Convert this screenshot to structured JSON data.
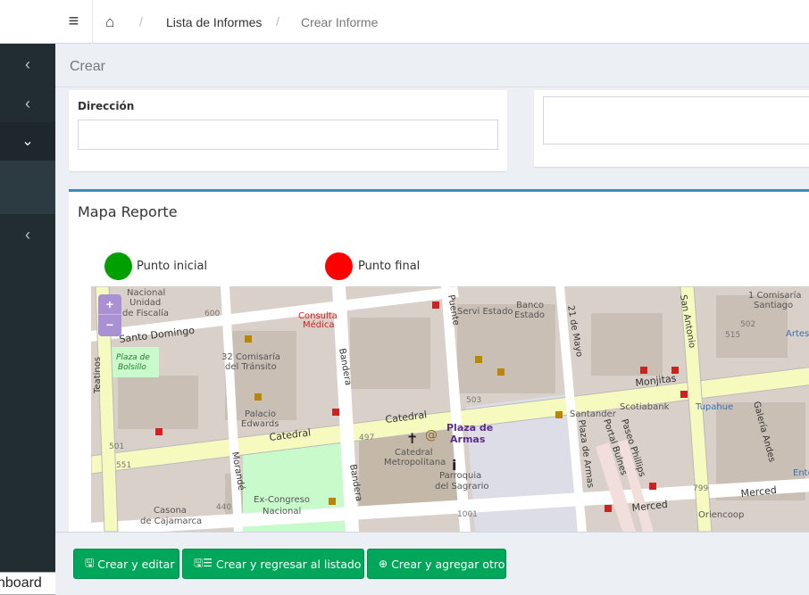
{
  "sidebar": {
    "items": [
      {
        "icon": "chevron-left-icon",
        "glyph": "‹"
      },
      {
        "icon": "chevron-left-icon",
        "glyph": "‹"
      },
      {
        "icon": "chevron-down-icon",
        "glyph": "⌄"
      },
      {
        "icon": "chevron-left-icon",
        "glyph": "‹"
      }
    ],
    "dashboard_label": "nboard"
  },
  "header": {
    "menu_glyph": "≡",
    "home_glyph": "⌂",
    "breadcrumb": [
      "Lista de Informes",
      "Crear Informe"
    ],
    "separator": "/"
  },
  "page": {
    "title": "Crear"
  },
  "form": {
    "direccion_label": "Dirección",
    "direccion_value": ""
  },
  "map_section": {
    "title": "Mapa Reporte",
    "legend": [
      {
        "label": "Punto inicial",
        "color": "#00a000"
      },
      {
        "label": "Punto final",
        "color": "#ff0000"
      }
    ],
    "zoom_in": "+",
    "zoom_out": "−",
    "labels": {
      "nacional": "Nacional",
      "unidad": "Unidad",
      "de_fiscalia": "de Fiscalía",
      "santo_domingo": "Santo Domingo",
      "plaza_bolsillo_1": "Plaza de",
      "plaza_bolsillo_2": "Bolsillo",
      "teatinos": "Teatinos",
      "comisaria_1": "32 Comisaría",
      "comisaria_2": "del Tránsito",
      "palacio_1": "Palacio",
      "palacio_2": "Edwards",
      "consulta_1": "Consulta",
      "consulta_2": "Médica",
      "bandera": "Bandera",
      "morande": "Morandé",
      "ex_congreso_1": "Ex-Congreso",
      "ex_congreso_2": "Nacional",
      "casona_1": "Casona",
      "casona_2": "de Cajamarca",
      "catedral_1": "Catedral",
      "catedral_2": "Catedral",
      "catedral_metro_1": "Catedral",
      "catedral_metro_2": "Metropolitana",
      "plaza_armas_1": "Plaza de",
      "plaza_armas_2": "Armas",
      "parroquia_1": "Parroquia",
      "parroquia_2": "del Sagrario",
      "puente": "Puente",
      "servi_estado": "Servi Estado",
      "banco_1": "Banco",
      "banco_2": "Estado",
      "mayo": "21 de Mayo",
      "santander": "Santander",
      "scotiabank": "Scotiabank",
      "portal_bulnes": "Portal Bulnes",
      "paseo_phillips": "Paseo Phillips",
      "plaza_de_armas_st": "Plaza de Armas",
      "monjitas": "Monjitas",
      "san_antonio": "San Antonio",
      "tupahue": "Tupahue",
      "galeria": "Galería Andes",
      "merced_1": "Merced",
      "merced_2": "Merced",
      "oriencoop": "Oriencoop",
      "comisaria_santiago_1": "1 Comisaría",
      "comisaria_santiago_2": "Santiago",
      "n600": "600",
      "n501": "501",
      "n551": "551",
      "n440": "440",
      "n497": "497",
      "n503": "503",
      "n1001": "1001",
      "n799": "799",
      "n515": "515",
      "n502": "502",
      "artes": "Artes",
      "ente": "Ente"
    }
  },
  "buttons": [
    {
      "label": "Crear y editar",
      "icon": "save-icon",
      "glyph": "🖫"
    },
    {
      "label": "Crear y regresar al listado",
      "icon": "save-list-icon",
      "glyph": "🖫☰"
    },
    {
      "label": "Crear y agregar otro",
      "icon": "plus-circle-icon",
      "glyph": "⊕"
    }
  ]
}
